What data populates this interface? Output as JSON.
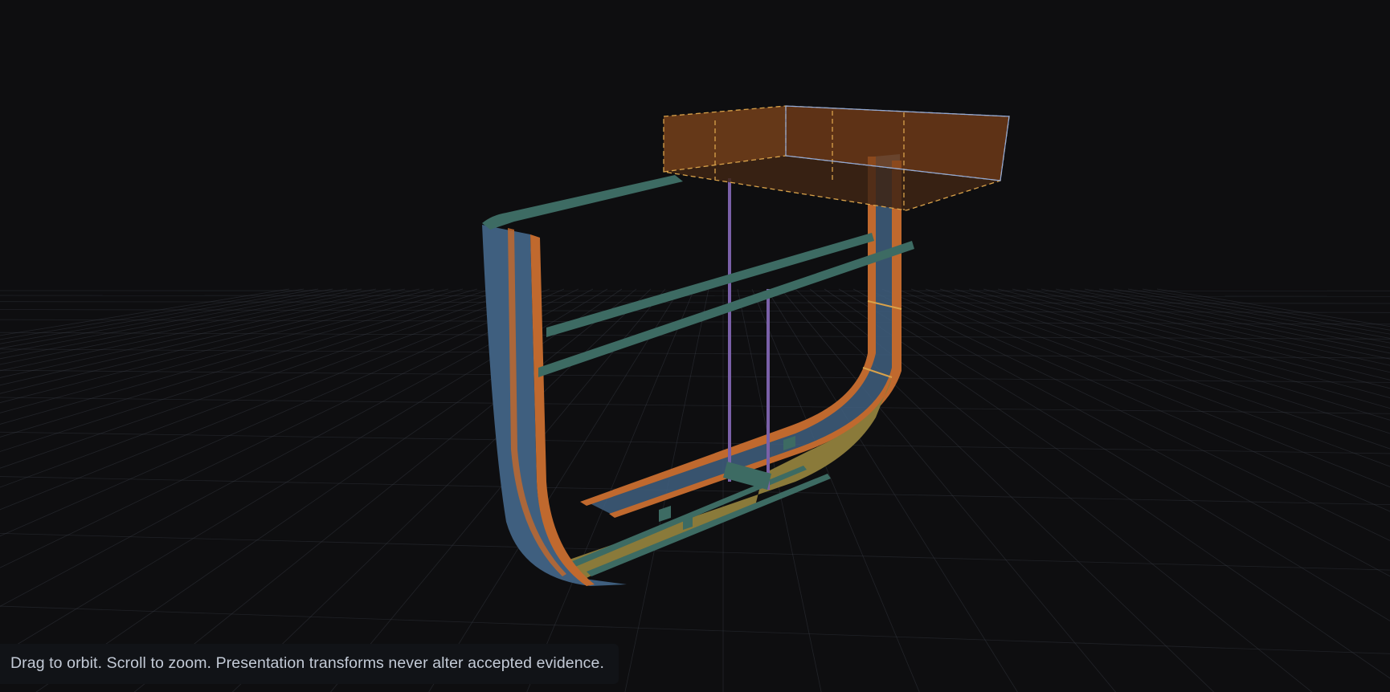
{
  "viewport": {
    "background": "#0e0e10",
    "grid_color": "#3a3e47"
  },
  "model": {
    "colors": {
      "shell_plate": "#3f5f7f",
      "shell_edge": "#c0692e",
      "bottom_plate": "#8a7a3a",
      "stiffener": "#3d6b63",
      "pillar": "#7a60a8",
      "selection_box_fill": "#8a4a1c",
      "selection_box_stroke": "#d9a24a",
      "bbox_stroke": "#8fa8d8"
    }
  },
  "hint": {
    "text": "Drag to orbit. Scroll to zoom. Presentation transforms never alter accepted evidence."
  }
}
